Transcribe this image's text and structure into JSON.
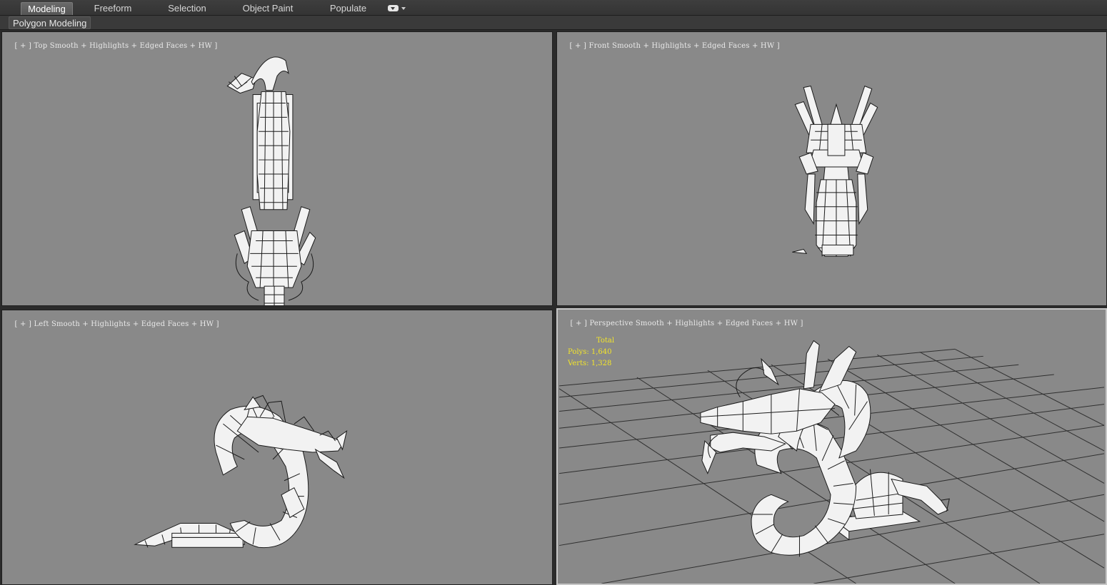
{
  "ribbon": {
    "tabs": [
      {
        "label": "Modeling",
        "active": true
      },
      {
        "label": "Freeform"
      },
      {
        "label": "Selection"
      },
      {
        "label": "Object Paint"
      },
      {
        "label": "Populate"
      }
    ],
    "menu_icon": "dropdown-pill-icon",
    "panel_label": "Polygon Modeling"
  },
  "viewports": {
    "top": {
      "plus": "[ + ]",
      "view": "Top",
      "shading": "Smooth + Highlights + Edged Faces + HW ]"
    },
    "front": {
      "plus": "[ + ]",
      "view": "Front",
      "shading": "Smooth + Highlights + Edged Faces + HW ]"
    },
    "left": {
      "plus": "[ + ]",
      "view": "Left",
      "shading": "Smooth + Highlights + Edged Faces + HW ]"
    },
    "perspective": {
      "plus": "[ + ]",
      "view": "Perspective",
      "shading": "Smooth + Highlights + Edged Faces + HW ]"
    }
  },
  "stats": {
    "header": "Total",
    "polys": "Polys: 1,640",
    "verts": "Verts: 1,328"
  },
  "colors": {
    "viewport_bg": "#898989",
    "stats_text": "#f3e52a",
    "ui_bg": "#2b2b2b",
    "active_border": "#c7c7c7"
  }
}
